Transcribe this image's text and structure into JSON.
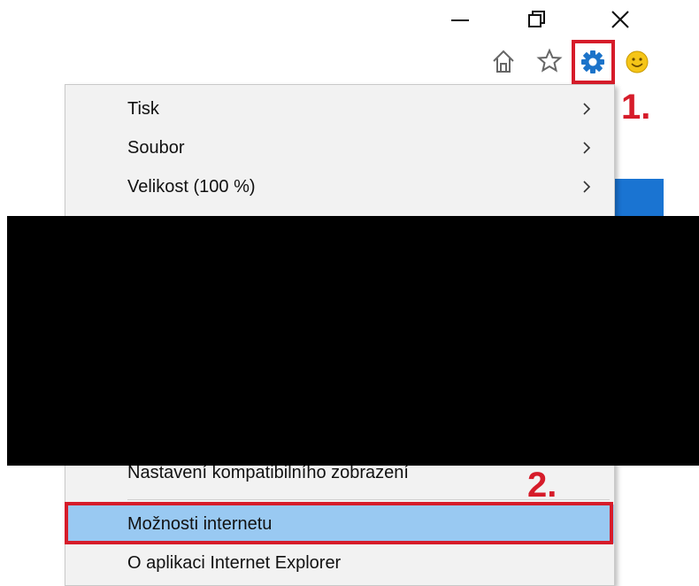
{
  "window_controls": {
    "minimize_icon": "minimize-icon",
    "restore_icon": "restore-icon",
    "close_icon": "close-icon"
  },
  "toolbar": {
    "icons": [
      "home-icon",
      "favorites-star-icon",
      "tools-gear-icon",
      "feedback-smiley-icon"
    ]
  },
  "annotations": {
    "step1": "1.",
    "step2": "2.",
    "accent_color": "#d61c2a"
  },
  "menu": {
    "items": [
      {
        "label": "Tisk",
        "submenu": true
      },
      {
        "label": "Soubor",
        "submenu": true
      },
      {
        "label": "Velikost (100 %)",
        "submenu": true
      },
      {
        "label": "Nastavení kompatibilního zobrazení",
        "submenu": false
      },
      {
        "label": "Možnosti internetu",
        "submenu": false,
        "highlighted": true
      },
      {
        "label": "O aplikaci Internet Explorer",
        "submenu": false
      }
    ],
    "highlight_color": "#99c9f2"
  }
}
